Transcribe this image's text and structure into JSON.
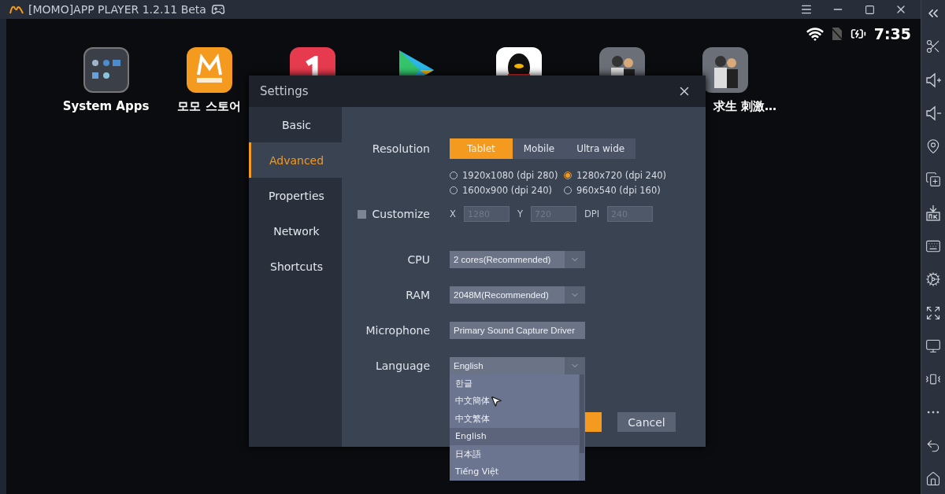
{
  "window": {
    "title": "[MOMO]APP PLAYER 1.2.11 Beta"
  },
  "status_bar": {
    "time": "7:35"
  },
  "apps": [
    {
      "label": "System Apps",
      "kind": "folder"
    },
    {
      "label": "모모 스토어",
      "kind": "store"
    },
    {
      "kind": "one"
    },
    {
      "kind": "play"
    },
    {
      "kind": "penguin"
    },
    {
      "kind": "game"
    },
    {
      "label": "求生 刺激…",
      "kind": "game"
    }
  ],
  "settings": {
    "title": "Settings",
    "nav": [
      {
        "label": "Basic",
        "selected": false
      },
      {
        "label": "Advanced",
        "selected": true
      },
      {
        "label": "Properties",
        "selected": false
      },
      {
        "label": "Network",
        "selected": false
      },
      {
        "label": "Shortcuts",
        "selected": false
      }
    ],
    "resolution": {
      "label": "Resolution",
      "modes": [
        {
          "label": "Tablet",
          "selected": true
        },
        {
          "label": "Mobile",
          "selected": false
        },
        {
          "label": "Ultra wide",
          "selected": false
        }
      ],
      "presets": [
        {
          "label": "1920x1080 (dpi 280)",
          "selected": false
        },
        {
          "label": "1280x720 (dpi 240)",
          "selected": true
        },
        {
          "label": "1600x900 (dpi 240)",
          "selected": false
        },
        {
          "label": "960x540 (dpi 160)",
          "selected": false
        }
      ]
    },
    "customize": {
      "label": "Customize",
      "checked": false,
      "fields": [
        {
          "label": "X",
          "value": "1280",
          "disabled": true
        },
        {
          "label": "Y",
          "value": "720",
          "disabled": true
        },
        {
          "label": "DPI",
          "value": "240",
          "disabled": true
        }
      ]
    },
    "selects": [
      {
        "label": "CPU",
        "value": "2 cores(Recommended)",
        "kind": "dropdown"
      },
      {
        "label": "RAM",
        "value": "2048M(Recommended)",
        "kind": "dropdown"
      },
      {
        "label": "Microphone",
        "value": "Primary Sound Capture Driver",
        "kind": "field"
      },
      {
        "label": "Language",
        "value": "English",
        "kind": "dropdown",
        "expanded": true,
        "options": [
          {
            "label": "한글",
            "selected": false
          },
          {
            "label": "中文簡体",
            "selected": false
          },
          {
            "label": "中文繁体",
            "selected": false
          },
          {
            "label": "English",
            "selected": true
          },
          {
            "label": "日本語",
            "selected": false
          },
          {
            "label": "Tiếng Việt",
            "selected": false
          }
        ]
      }
    ],
    "buttons": [
      {
        "kind": "primary"
      },
      {
        "label": "Cancel",
        "kind": "secondary"
      }
    ]
  }
}
